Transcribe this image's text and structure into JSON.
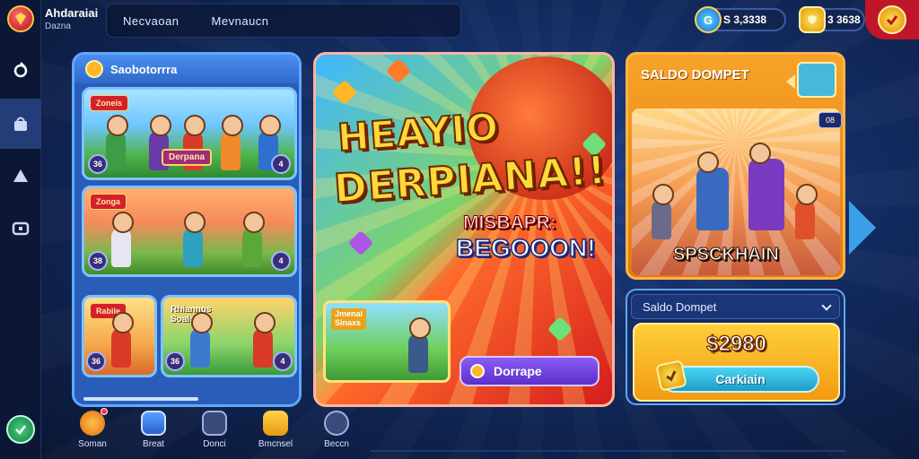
{
  "header": {
    "brand_title": "Ahdaraiai",
    "brand_subtitle": "Dazna",
    "nav": [
      "Necvaoan",
      "Mevnaucn"
    ],
    "currency_1": {
      "icon": "blue-coin-icon",
      "glyph": "G",
      "value": "S 3,3338"
    },
    "currency_2": {
      "icon": "gold-shield-icon",
      "value": "3 3638"
    }
  },
  "sidebar": {
    "icons": [
      "home-icon",
      "gift-icon",
      "hat-icon",
      "chest-icon"
    ],
    "active_index": 1
  },
  "left_panel": {
    "title": "Saobotorrra",
    "cards": [
      {
        "tag": "Zoneis",
        "label": "Derpana",
        "badge_left": "36",
        "badge_right": "4"
      },
      {
        "tag": "Zonga",
        "badge_left": "38",
        "badge_right": "4"
      },
      {
        "tag": "Rabile",
        "badge_left": "36"
      },
      {
        "label": "Rhianngs\nSoalsi",
        "badge_left": "36",
        "badge_right": "4"
      }
    ]
  },
  "banner": {
    "title_line1": "HEAYIO",
    "title_line2": "DERPIANA!!",
    "sub_line1": "MISBAPR:",
    "sub_line2": "BEGOOON!",
    "mini_label": "Jmenai\nSinaxs",
    "cta_label": "Dorrape"
  },
  "right_card": {
    "title": "SALDO DOMPET",
    "badge": "08",
    "label": "SPSCKHAIN"
  },
  "wallet": {
    "select_label": "Saldo Dompet",
    "amount": "$2980",
    "button_label": "Carkiain"
  },
  "bottom_nav": [
    {
      "icon": "trophy-icon",
      "label": "Soman",
      "has_dot": true,
      "color": "#ff9a1f"
    },
    {
      "icon": "phone-icon",
      "label": "Breat",
      "color": "#3b7fe0"
    },
    {
      "icon": "cart-icon",
      "label": "Donci",
      "color": "#4a5a8a"
    },
    {
      "icon": "bag-icon",
      "label": "Bmcnsel",
      "color": "#f5b82a"
    },
    {
      "icon": "profile-icon",
      "label": "Beccn",
      "color": "#4a5a8a"
    }
  ],
  "colors": {
    "accent": "#f29a12",
    "primary": "#2a5db8",
    "alert": "#d41d1d"
  }
}
